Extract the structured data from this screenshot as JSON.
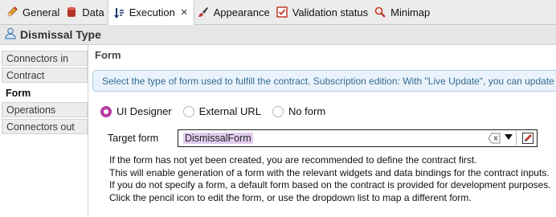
{
  "tabs": [
    {
      "label": "General",
      "icon": "pencil-icon"
    },
    {
      "label": "Data",
      "icon": "database-icon"
    },
    {
      "label": "Execution",
      "icon": "execution-icon",
      "active": true
    },
    {
      "label": "Appearance",
      "icon": "paint-icon"
    },
    {
      "label": "Validation status",
      "icon": "checkbox-icon"
    },
    {
      "label": "Minimap",
      "icon": "magnifier-icon"
    }
  ],
  "header": {
    "title": "Dismissal Type",
    "icon": "user-icon"
  },
  "sidebar": {
    "items": [
      {
        "label": "Connectors in"
      },
      {
        "label": "Contract"
      },
      {
        "label": "Form",
        "active": true
      },
      {
        "label": "Operations"
      },
      {
        "label": "Connectors out"
      }
    ]
  },
  "main": {
    "title": "Form",
    "info": "Select the type of form used to fulfill the contract. Subscription edition: With \"Live Update\", you can update",
    "radio_options": [
      {
        "label": "UI Designer",
        "selected": true
      },
      {
        "label": "External URL",
        "selected": false
      },
      {
        "label": "No form",
        "selected": false
      }
    ],
    "target_form_label": "Target form",
    "target_form_value": "DismissalForm",
    "help_lines": [
      "If the form has not yet been created, you are recommended to define the contract first.",
      "This will enable generation of a form with the relevant widgets and data bindings for the contract inputs.",
      "If you do not specify a form, a default form based on the contract is provided for development purposes.",
      "Click the pencil icon to edit the form, or use the dropdown list to map a different form."
    ]
  },
  "colors": {
    "accent": "#b73ca3",
    "info_bg": "#eaf3fb",
    "info_text": "#336b94"
  }
}
